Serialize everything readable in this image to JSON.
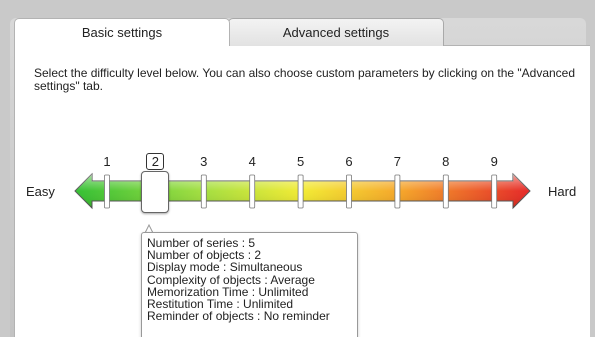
{
  "tabs": [
    {
      "label": "Basic settings",
      "active": true
    },
    {
      "label": "Advanced settings",
      "active": false
    }
  ],
  "description": "Select the difficulty level below. You can also choose custom parameters by clicking on the \"Advanced settings\" tab.",
  "slider": {
    "min_label": "Easy",
    "max_label": "Hard",
    "levels": [
      "1",
      "2",
      "3",
      "4",
      "5",
      "6",
      "7",
      "8",
      "9"
    ],
    "selected": "2"
  },
  "tooltip": {
    "lines": [
      "Number of series : 5",
      "Number of objects : 2",
      "Display mode : Simultaneous",
      "Complexity of objects : Average",
      "Memorization Time : Unlimited",
      "Restitution Time : Unlimited",
      "Reminder of objects : No reminder"
    ]
  }
}
